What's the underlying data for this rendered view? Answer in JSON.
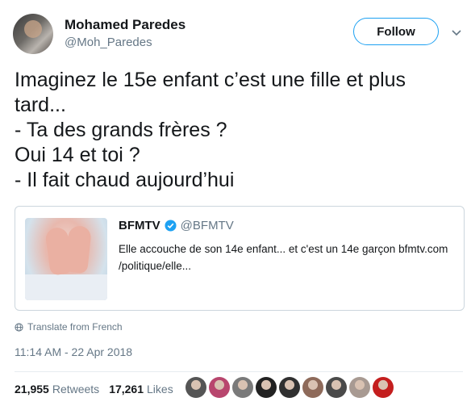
{
  "author": {
    "name": "Mohamed Paredes",
    "handle": "@Moh_Paredes",
    "avatar_icon": "user-avatar"
  },
  "follow_label": "Follow",
  "tweet_lines": [
    "Imaginez le 15e enfant c’est une fille et plus",
    "tard...",
    "- Ta des grands frères ?",
    "Oui 14 et toi ?",
    "- Il fait chaud aujourd’hui"
  ],
  "quoted": {
    "name": "BFMTV",
    "handle": "@BFMTV",
    "verified": true,
    "text_lines": [
      "Elle accouche de son 14e enfant... et c'est un 14e garçon bfmtv.com",
      "/politique/elle..."
    ]
  },
  "translate_label": "Translate from French",
  "timestamp": "11:14 AM - 22 Apr 2018",
  "stats": {
    "retweets_count": "21,955",
    "retweets_label": "Retweets",
    "likes_count": "17,261",
    "likes_label": "Likes"
  },
  "liker_avatars": [
    {
      "color": "#555555"
    },
    {
      "color": "#b8466e"
    },
    {
      "color": "#7a7a7a"
    },
    {
      "color": "#222222"
    },
    {
      "color": "#303030"
    },
    {
      "color": "#8e6a5a"
    },
    {
      "color": "#4a4a4a"
    },
    {
      "color": "#a89a92"
    },
    {
      "color": "#c41e1e"
    }
  ],
  "colors": {
    "accent": "#1da1f2",
    "text": "#14171a",
    "secondary": "#657786",
    "border": "#ccd6dd"
  }
}
